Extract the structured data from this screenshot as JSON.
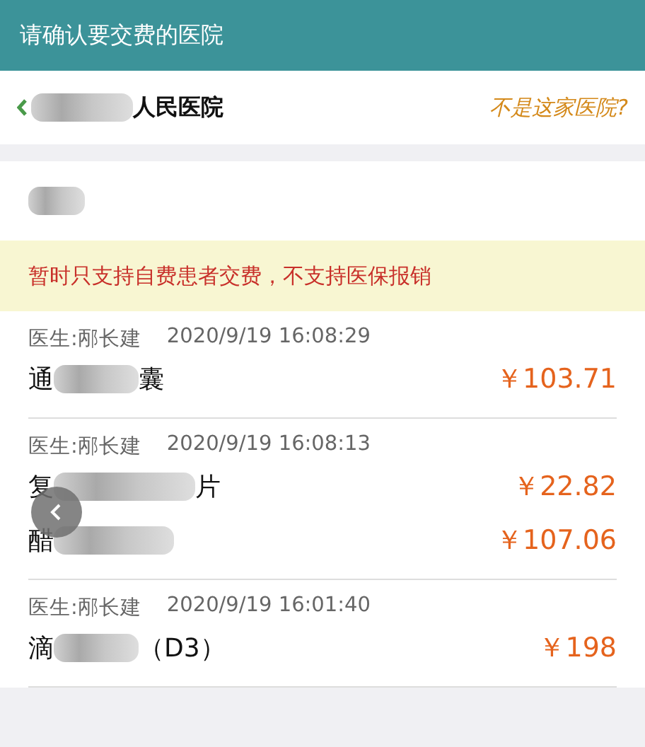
{
  "header": {
    "title": "请确认要交费的医院"
  },
  "hospital": {
    "name_suffix": "人民医院",
    "change_link": "不是这家医院?"
  },
  "notice": "暂时只支持自费患者交费，不支持医保报销",
  "prescriptions": [
    {
      "doctor": "医生:邴长建",
      "time": "2020/9/19 16:08:29",
      "items": [
        {
          "prefix": "通",
          "suffix": "囊",
          "price": "￥103.71"
        }
      ]
    },
    {
      "doctor": "医生:邴长建",
      "time": "2020/9/19 16:08:13",
      "items": [
        {
          "prefix": "复",
          "suffix": "片",
          "price": "￥22.82"
        },
        {
          "prefix": "醋",
          "price": "￥107.06"
        }
      ]
    },
    {
      "doctor": "医生:邴长建",
      "time": "2020/9/19 16:01:40",
      "items": [
        {
          "prefix": "滴",
          "suffix": "（D3）",
          "price": "￥198"
        }
      ]
    }
  ]
}
